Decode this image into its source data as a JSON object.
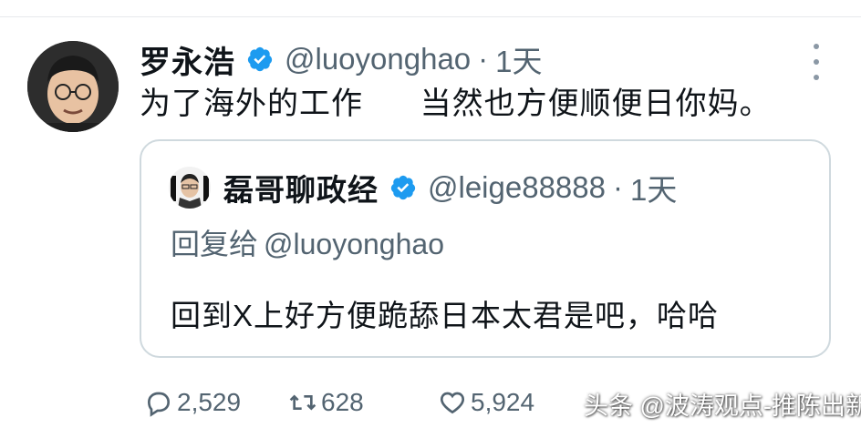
{
  "tweet": {
    "display_name": "罗永浩",
    "handle": "@luoyonghao",
    "separator": "·",
    "time": "1天",
    "text": "为了海外的工作      当然也方便顺便日你妈。"
  },
  "quoted_tweet": {
    "display_name": "磊哥聊政经",
    "handle": "@leige88888",
    "separator": "·",
    "time": "1天",
    "reply_prefix": "回复给",
    "reply_handle": "@luoyonghao",
    "text": "回到X上好方便跪舔日本太君是吧，哈哈"
  },
  "actions": {
    "reply_count": "2,529",
    "retweet_count": "628",
    "like_count": "5,924"
  },
  "watermark": "头条 @波涛观点-推陈出新",
  "icons": {
    "verified": "verified-badge-icon",
    "more": "more-vertical-icon",
    "reply": "reply-icon",
    "retweet": "retweet-icon",
    "like": "like-icon"
  },
  "colors": {
    "verified": "#1d9bf0",
    "secondary_text": "#536471",
    "border": "#cfd9de"
  }
}
